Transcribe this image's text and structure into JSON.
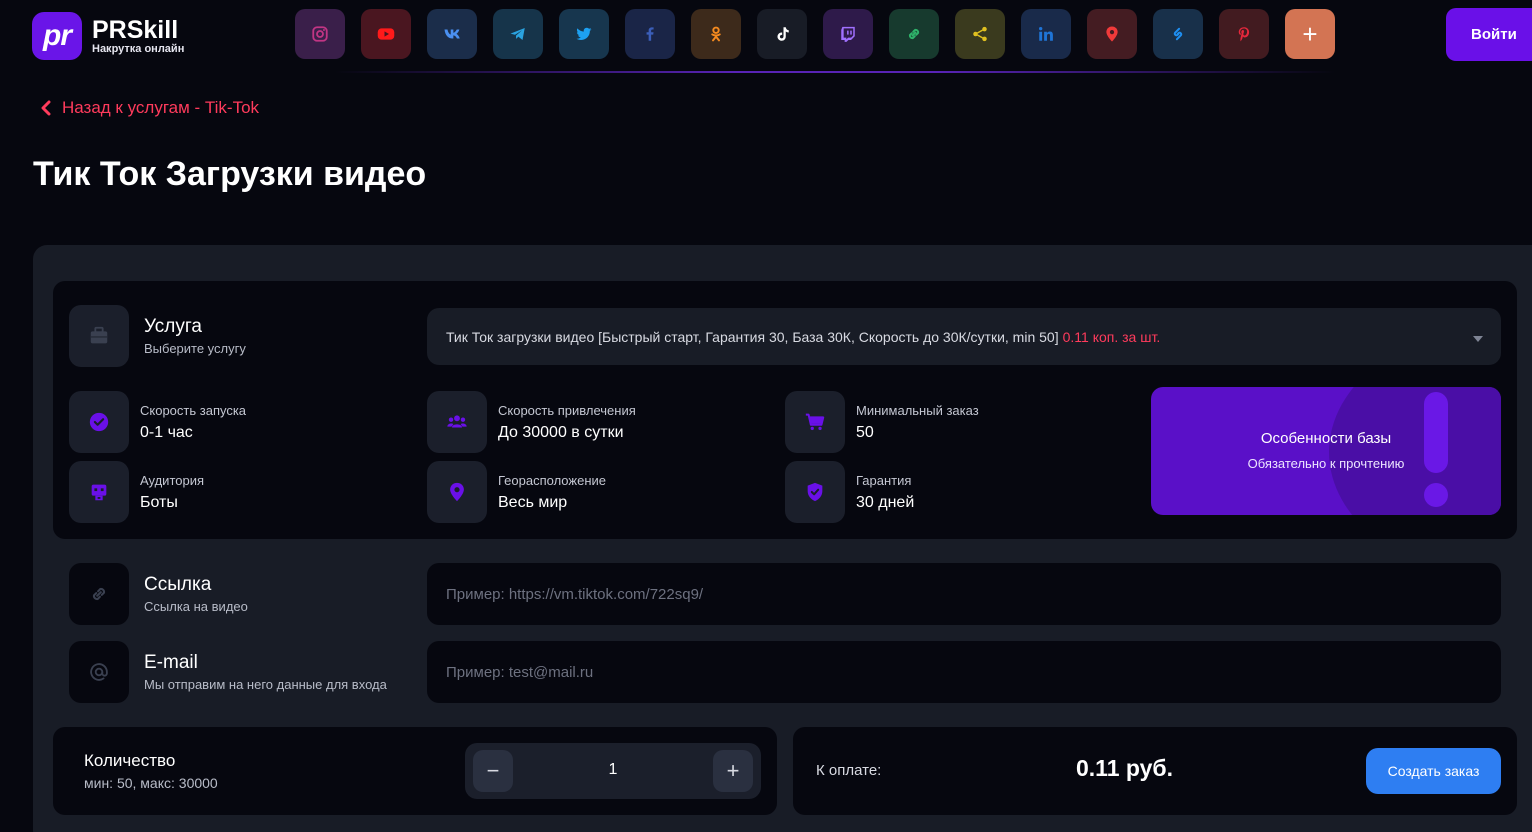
{
  "brand": {
    "logo_mark": "pr",
    "name": "PRSkill",
    "tagline": "Накрутка онлайн"
  },
  "header": {
    "social_networks": [
      {
        "name": "instagram-icon",
        "bg": "#3a1f4a",
        "fg": "#c13584"
      },
      {
        "name": "youtube-icon",
        "bg": "#4a1620",
        "fg": "#ff1a1a"
      },
      {
        "name": "vk-icon",
        "bg": "#1b2d4a",
        "fg": "#4a8ff0"
      },
      {
        "name": "telegram-icon",
        "bg": "#16344a",
        "fg": "#2aa3e0"
      },
      {
        "name": "twitter-icon",
        "bg": "#17364e",
        "fg": "#1da1f2"
      },
      {
        "name": "facebook-icon",
        "bg": "#1a2547",
        "fg": "#3b5eb8"
      },
      {
        "name": "odnoklassniki-icon",
        "bg": "#3d2a1b",
        "fg": "#f58a1f"
      },
      {
        "name": "tiktok-icon",
        "bg": "#181c26",
        "fg": "#ffffff"
      },
      {
        "name": "twitch-icon",
        "bg": "#2e1a4a",
        "fg": "#a070ff"
      },
      {
        "name": "link-icon",
        "bg": "#173a2e",
        "fg": "#2fb36a"
      },
      {
        "name": "share-icon",
        "bg": "#3a3a1e",
        "fg": "#e0c020"
      },
      {
        "name": "linkedin-icon",
        "bg": "#192a4a",
        "fg": "#1f74d6"
      },
      {
        "name": "map-pin-icon",
        "bg": "#441c22",
        "fg": "#f03a3a"
      },
      {
        "name": "shazam-icon",
        "bg": "#18304a",
        "fg": "#1e8ef0"
      },
      {
        "name": "pinterest-icon",
        "bg": "#421b20",
        "fg": "#e6283c"
      },
      {
        "name": "plus-icon",
        "bg": "#d37453",
        "fg": "#ffffff",
        "glyph": "+"
      }
    ],
    "login_label": "Войти"
  },
  "back_link": {
    "label": "Назад к услугам - Tik-Tok"
  },
  "page_title": "Тик Ток Загрузки видео",
  "service": {
    "title": "Услуга",
    "subtitle": "Выберите услугу",
    "selected": "Тик Ток загрузки видео [Быстрый старт, Гарантия 30, База 30К, Скорость до 30К/сутки, min 50]",
    "price": "0.11 коп. за шт."
  },
  "features": [
    {
      "label": "Скорость запуска",
      "value": "0-1 час",
      "icon": "clock-check-icon"
    },
    {
      "label": "Скорость привлечения",
      "value": "До 30000 в сутки",
      "icon": "users-icon"
    },
    {
      "label": "Минимальный заказ",
      "value": "50",
      "icon": "cart-icon"
    },
    {
      "label": "Аудитория",
      "value": "Боты",
      "icon": "bot-icon"
    },
    {
      "label": "Георасположение",
      "value": "Весь мир",
      "icon": "location-icon"
    },
    {
      "label": "Гарантия",
      "value": "30 дней",
      "icon": "shield-check-icon"
    }
  ],
  "notice": {
    "title": "Особенности базы",
    "subtitle": "Обязательно к прочтению"
  },
  "link_field": {
    "title": "Ссылка",
    "subtitle": "Ссылка на видео",
    "placeholder": "Пример: https://vm.tiktok.com/722sq9/"
  },
  "email_field": {
    "title": "E-mail",
    "subtitle": "Мы отправим на него данные для входа",
    "placeholder": "Пример: test@mail.ru"
  },
  "quantity": {
    "title": "Количество",
    "subtitle": "мин: 50, макс: 30000",
    "value": "1",
    "minus": "−",
    "plus": "+"
  },
  "payment": {
    "label": "К оплате:",
    "amount": "0.11 руб.",
    "button": "Создать заказ"
  },
  "colors": {
    "accent": "#6a10e8",
    "danger": "#ff3b5c",
    "primary_button": "#2e7ef2",
    "feature_icon": "#6a10e8"
  }
}
